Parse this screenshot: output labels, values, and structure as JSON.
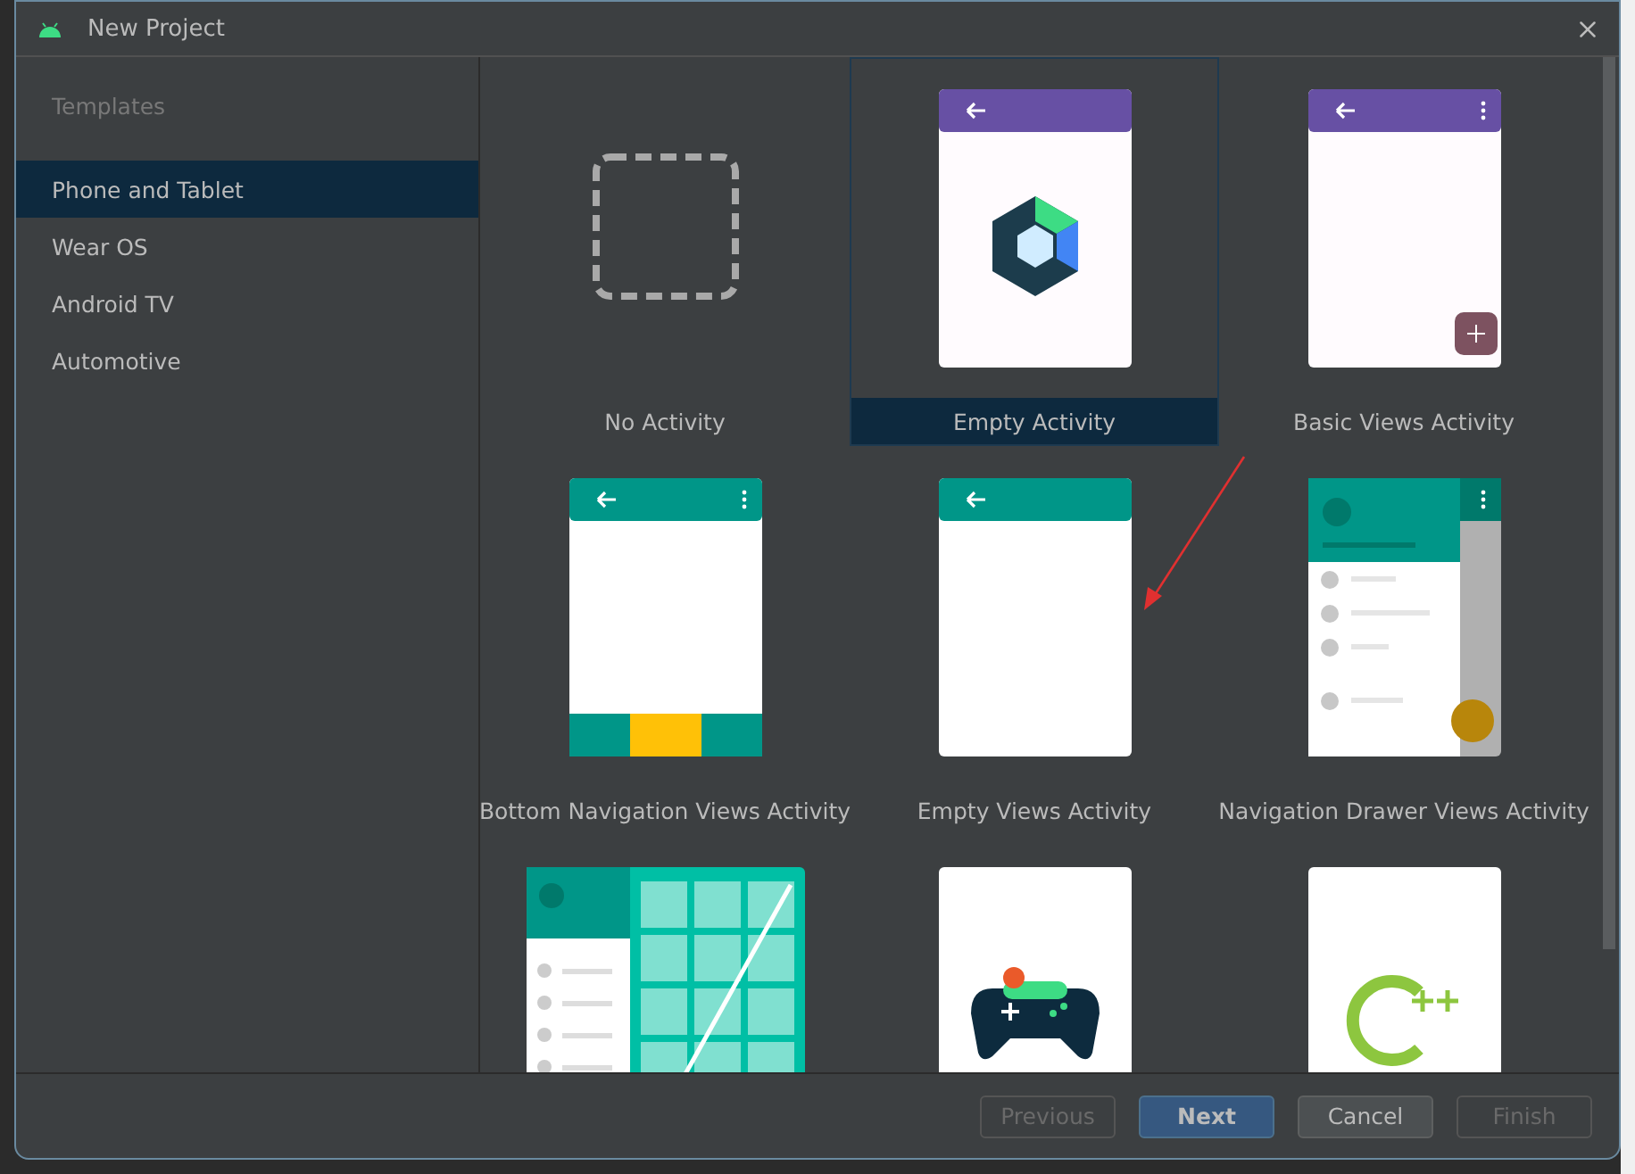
{
  "window": {
    "title": "New Project"
  },
  "sidebar": {
    "heading": "Templates",
    "items": [
      {
        "label": "Phone and Tablet",
        "selected": true
      },
      {
        "label": "Wear OS",
        "selected": false
      },
      {
        "label": "Android TV",
        "selected": false
      },
      {
        "label": "Automotive",
        "selected": false
      }
    ]
  },
  "templates": [
    {
      "kind": "none",
      "label": "No Activity",
      "selected": false
    },
    {
      "kind": "compose",
      "label": "Empty Activity",
      "selected": true
    },
    {
      "kind": "basic",
      "label": "Basic Views Activity",
      "selected": false
    },
    {
      "kind": "bottom_nav",
      "label": "Bottom Navigation Views Activity",
      "selected": false
    },
    {
      "kind": "empty_views",
      "label": "Empty Views Activity",
      "selected": false
    },
    {
      "kind": "nav_drawer",
      "label": "Navigation Drawer Views Activity",
      "selected": false
    },
    {
      "kind": "responsive",
      "selected": false
    },
    {
      "kind": "game",
      "selected": false
    },
    {
      "kind": "cpp",
      "selected": false
    }
  ],
  "buttons": [
    {
      "label": "Previous",
      "disabled": true,
      "default": false
    },
    {
      "label": "Next",
      "disabled": false,
      "default": true
    },
    {
      "label": "Cancel",
      "disabled": false,
      "default": false
    },
    {
      "label": "Finish",
      "disabled": true,
      "default": false
    }
  ]
}
